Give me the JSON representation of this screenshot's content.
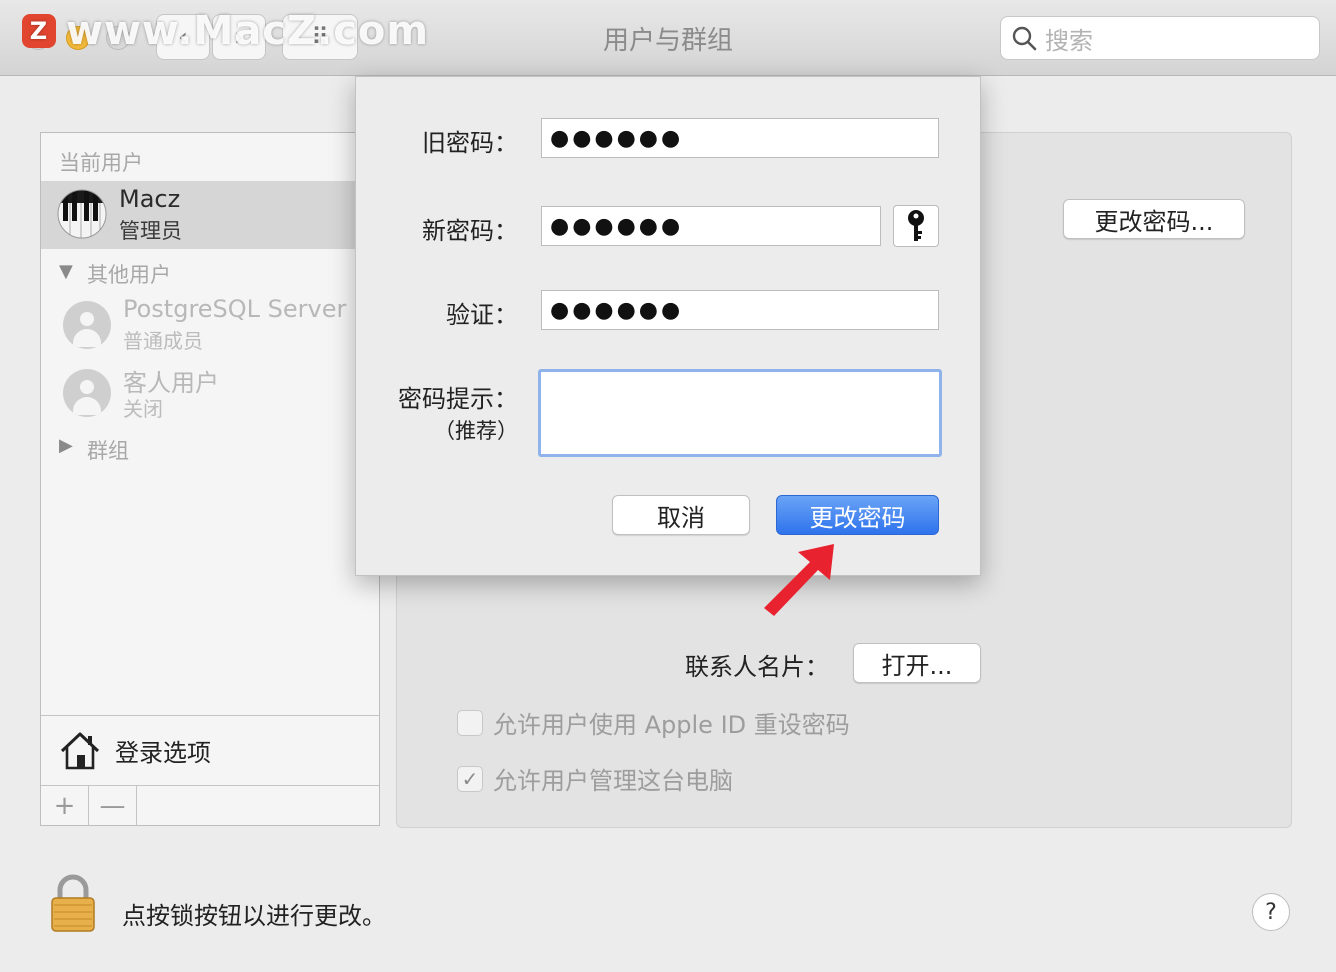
{
  "watermark": {
    "logo": "Z",
    "text": "www.MacZ.com"
  },
  "window": {
    "title": "用户与群组"
  },
  "toolbar": {
    "back": "‹",
    "forward": "›",
    "grid": "⠿",
    "search_placeholder": "搜索",
    "search_icon": "search-icon"
  },
  "sidebar": {
    "current_label": "当前用户",
    "current_user": {
      "name": "Macz",
      "role": "管理员"
    },
    "other_label": "其他用户",
    "others": [
      {
        "name": "PostgreSQL Server",
        "role": "普通成员"
      },
      {
        "name": "客人用户",
        "role": "关闭"
      }
    ],
    "groups_label": "群组",
    "login_options": "登录选项",
    "add": "+",
    "remove": "—"
  },
  "main": {
    "change_password_button": "更改密码...",
    "contact_card_label": "联系人名片：",
    "open_button": "打开...",
    "checkbox_apple_id": {
      "label": "允许用户使用 Apple ID 重设密码",
      "checked": false
    },
    "checkbox_admin": {
      "label": "允许用户管理这台电脑",
      "checked": true
    }
  },
  "dialog": {
    "old_password_label": "旧密码：",
    "old_password_value": "●●●●●●",
    "new_password_label": "新密码：",
    "new_password_value": "●●●●●●",
    "verify_label": "验证：",
    "verify_value": "●●●●●●",
    "hint_label": "密码提示：",
    "hint_sub_label": "（推荐）",
    "hint_value": "",
    "cancel_button": "取消",
    "confirm_button": "更改密码"
  },
  "footer": {
    "lock_text": "点按锁按钮以进行更改。",
    "help": "?"
  },
  "colors": {
    "accent": "#2f73ec",
    "arrow": "#e8222e",
    "lock": "#e8b04a"
  }
}
